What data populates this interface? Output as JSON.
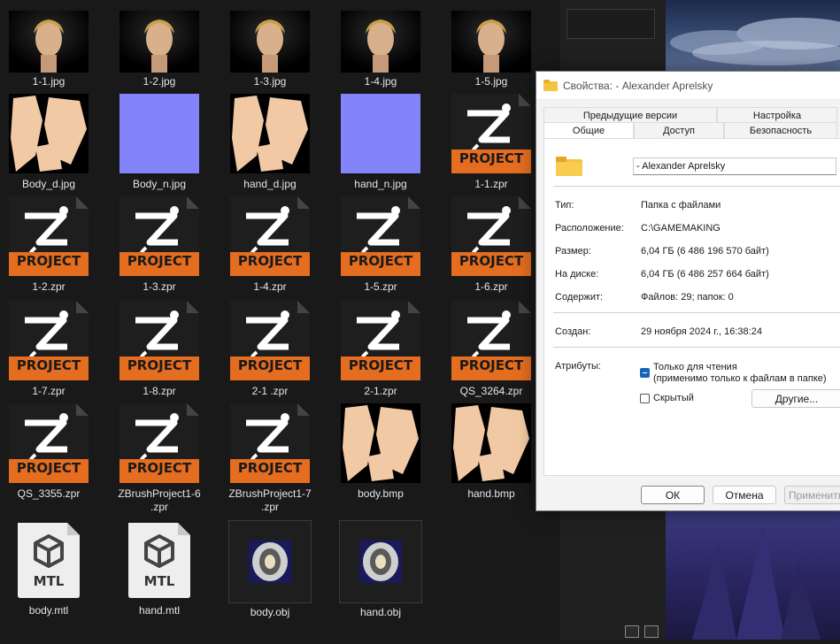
{
  "explorer": {
    "files": [
      {
        "name": "1-1.jpg",
        "kind": "face"
      },
      {
        "name": "1-2.jpg",
        "kind": "face"
      },
      {
        "name": "1-3.jpg",
        "kind": "face"
      },
      {
        "name": "1-4.jpg",
        "kind": "face"
      },
      {
        "name": "1-5.jpg",
        "kind": "face"
      },
      {
        "name": "Body_d.jpg",
        "kind": "skin"
      },
      {
        "name": "Body_n.jpg",
        "kind": "normal"
      },
      {
        "name": "hand_d.jpg",
        "kind": "skin"
      },
      {
        "name": "hand_n.jpg",
        "kind": "normal"
      },
      {
        "name": "1-1.zpr",
        "kind": "zpr"
      },
      {
        "name": "1-2.zpr",
        "kind": "zpr"
      },
      {
        "name": "1-3.zpr",
        "kind": "zpr"
      },
      {
        "name": "1-4.zpr",
        "kind": "zpr"
      },
      {
        "name": "1-5.zpr",
        "kind": "zpr"
      },
      {
        "name": "1-6.zpr",
        "kind": "zpr"
      },
      {
        "name": "1-7.zpr",
        "kind": "zpr"
      },
      {
        "name": "1-8.zpr",
        "kind": "zpr"
      },
      {
        "name": "2-1 .zpr",
        "kind": "zpr"
      },
      {
        "name": "2-1.zpr",
        "kind": "zpr"
      },
      {
        "name": "QS_3264.zpr",
        "kind": "zpr"
      },
      {
        "name": "QS_3355.zpr",
        "kind": "zpr"
      },
      {
        "name": "ZBrushProject1-6\n.zpr",
        "kind": "zpr"
      },
      {
        "name": "ZBrushProject1-7\n.zpr",
        "kind": "zpr"
      },
      {
        "name": "body.bmp",
        "kind": "skin"
      },
      {
        "name": "hand.bmp",
        "kind": "skin"
      },
      {
        "name": "body.mtl",
        "kind": "mtl"
      },
      {
        "name": "hand.mtl",
        "kind": "mtl"
      },
      {
        "name": "body.obj",
        "kind": "obj"
      },
      {
        "name": "hand.obj",
        "kind": "obj"
      }
    ],
    "zpr_badge": "PROJECT",
    "mtl_badge": "MTL"
  },
  "dialog": {
    "title": "Свойства: - Alexander Aprelsky",
    "tabs_back": [
      "Предыдущие версии",
      "Настройка"
    ],
    "tabs_front": [
      "Общие",
      "Доступ",
      "Безопасность"
    ],
    "folder_name": "- Alexander Aprelsky",
    "props": [
      {
        "key": "Тип:",
        "value": "Папка с файлами"
      },
      {
        "key": "Расположение:",
        "value": "C:\\GAMEMAKING"
      },
      {
        "key": "Размер:",
        "value": "6,04 ГБ (6 486 196 570 байт)"
      },
      {
        "key": "На диске:",
        "value": "6,04 ГБ (6 486 257 664 байт)"
      },
      {
        "key": "Содержит:",
        "value": "Файлов: 29; папок: 0"
      }
    ],
    "created_key": "Создан:",
    "created_value": "29 ноября 2024 г., 16:38:24",
    "attributes_key": "Атрибуты:",
    "readonly_label": "Только для чтения",
    "readonly_note": "(применимо только к файлам в папке)",
    "hidden_label": "Скрытый",
    "other_button": "Другие...",
    "ok_button": "ОК",
    "cancel_button": "Отмена",
    "apply_button": "Применить"
  },
  "colors": {
    "explorer_bg": "#191919",
    "zpr_orange": "#e46d1f",
    "normal_map": "#8383fa",
    "skin": "#f1c9a4",
    "accent": "#1a64b8"
  }
}
